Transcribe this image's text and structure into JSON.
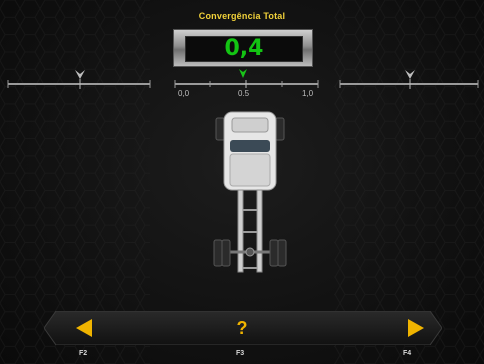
{
  "screen": {
    "title": "Convergência Total",
    "value": "0,4"
  },
  "scale": {
    "tick_labels": [
      "0,0",
      "0.5",
      "1,0"
    ]
  },
  "function_keys": {
    "left_key": "F2",
    "help_key": "F3",
    "right_key": "F4",
    "help_symbol": "?"
  },
  "colors": {
    "title": "#f2d23a",
    "value": "#13c413",
    "marker": "#19c419",
    "nav_arrow": "#f0b400"
  },
  "icons": {
    "left": "arrow-left-icon",
    "help": "question-icon",
    "right": "arrow-right-icon"
  }
}
